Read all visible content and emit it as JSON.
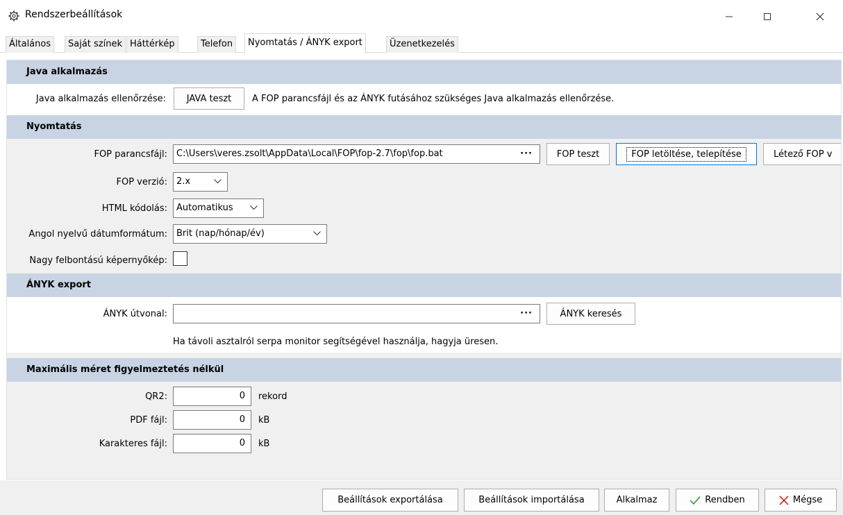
{
  "window": {
    "title": "Rendszerbeállítások",
    "icon": "gear-icon",
    "controls": {
      "minimize": "minimize-icon",
      "maximize": "maximize-icon",
      "close": "close-icon"
    }
  },
  "tabs": [
    {
      "label": "Általános",
      "active": false
    },
    {
      "label": "Saját színek",
      "active": false
    },
    {
      "label": "Háttérkép",
      "active": false
    },
    {
      "label": "Telefon",
      "active": false
    },
    {
      "label": "Nyomtatás / ÁNYK export",
      "active": true
    },
    {
      "label": "Üzenetkezelés",
      "active": false
    }
  ],
  "java": {
    "header": "Java alkalmazás",
    "check_label": "Java alkalmazás ellenőrzése:",
    "test_button": "JAVA teszt",
    "description": "A FOP parancsfájl és az ÁNYK futásához szükséges Java alkalmazás ellenőrzése."
  },
  "print": {
    "header": "Nyomtatás",
    "fop_label": "FOP parancsfájl:",
    "fop_value": "C:\\Users\\veres.zsolt\\AppData\\Local\\FOP\\fop-2.7\\fop\\fop.bat",
    "browse": "···",
    "fop_test_button": "FOP teszt",
    "fop_download_button": "FOP letöltése, telepítése",
    "fop_existing_button": "Létező FOP v",
    "version_label": "FOP verzió:",
    "version_value": "2.x",
    "html_label": "HTML kódolás:",
    "html_value": "Automatikus",
    "date_label": "Angol nyelvű dátumformátum:",
    "date_value": "Brit (nap/hónap/év)",
    "hires_label": "Nagy felbontású képernyőkép:",
    "hires_checked": false
  },
  "anyk": {
    "header": "ÁNYK export",
    "path_label": "ÁNYK útvonal:",
    "path_value": "",
    "browse": "···",
    "search_button": "ÁNYK keresés",
    "hint": "Ha távoli asztalról serpa monitor segítségével használja, hagyja üresen."
  },
  "maxsize": {
    "header": "Maximális méret figyelmeztetés nélkül",
    "rows": [
      {
        "label": "QR2:",
        "value": "0",
        "unit": "rekord"
      },
      {
        "label": "PDF fájl:",
        "value": "0",
        "unit": "kB"
      },
      {
        "label": "Karakteres fájl:",
        "value": "0",
        "unit": "kB"
      }
    ]
  },
  "footer": {
    "export": "Beállítások exportálása",
    "import": "Beállítások importálása",
    "apply": "Alkalmaz",
    "ok": "Rendben",
    "cancel": "Mégse",
    "ok_color": "#2e9b3a",
    "cancel_color": "#d9262b"
  }
}
